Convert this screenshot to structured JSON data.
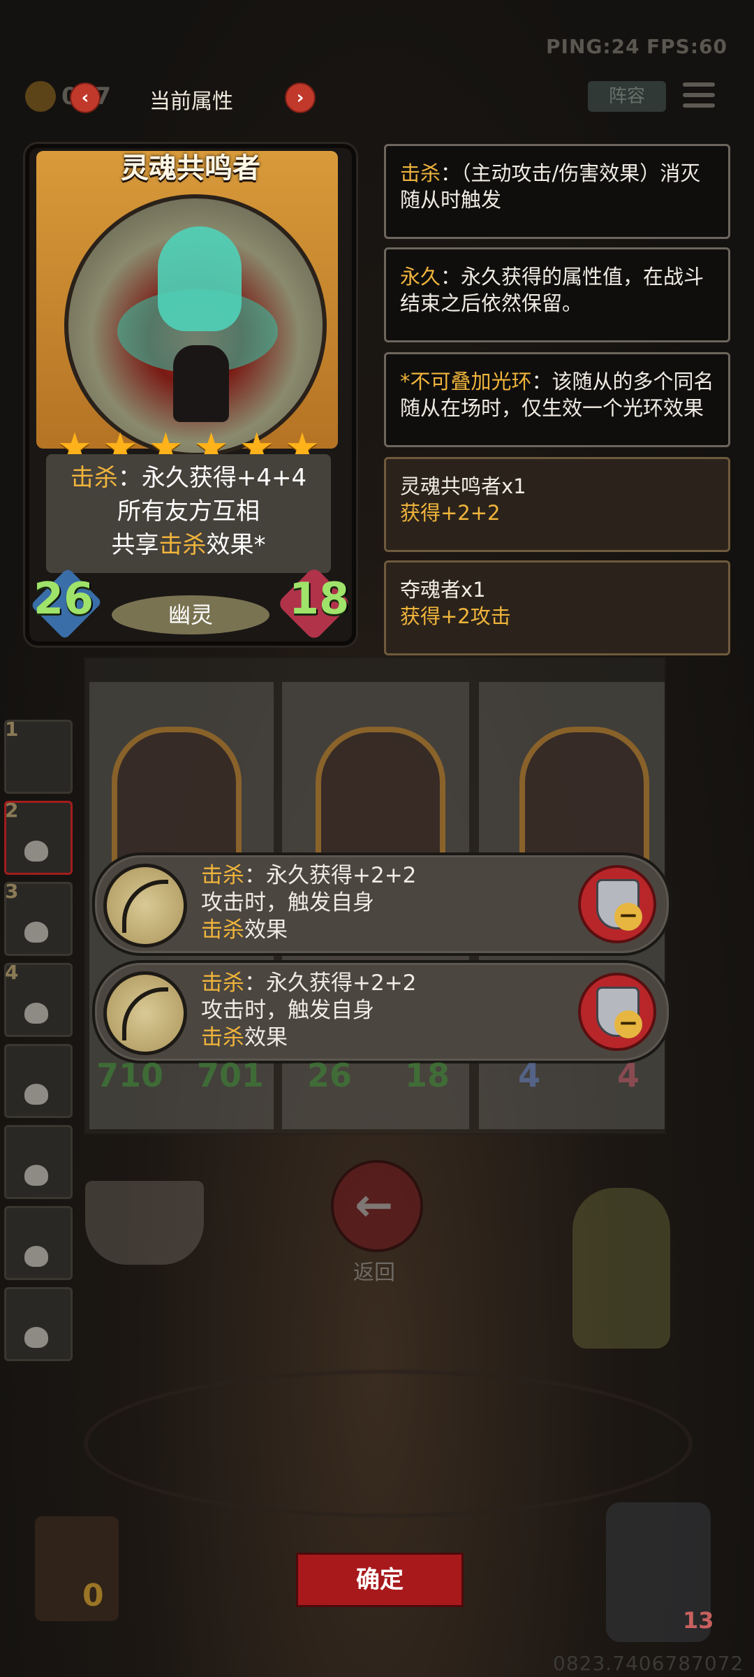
{
  "hud": {
    "ping": "PING:24",
    "fps": "FPS:60",
    "gold_amount": "017",
    "panel_title": "当前属性",
    "prev_arrow": "‹",
    "next_arrow": "›",
    "lineup_label": "阵容"
  },
  "card": {
    "name": "灵魂共鸣者",
    "stars": 6,
    "star_glyph": "★",
    "text_line1_kw": "击杀",
    "text_line1_rest": "：永久获得+4+4",
    "text_line2": "所有友方互相",
    "text_line3_pre": "共享",
    "text_line3_kw": "击杀",
    "text_line3_post": "效果*",
    "attack": "26",
    "health": "18",
    "tribe": "幽灵"
  },
  "tips": [
    {
      "kw": "击杀",
      "rest": "：（主动攻击/伤害效果）消灭随从时触发",
      "style": "dark"
    },
    {
      "kw": "永久",
      "rest": "：永久获得的属性值，在战斗结束之后依然保留。",
      "style": "dark"
    },
    {
      "kw": "*不可叠加光环",
      "rest": "：该随从的多个同名随从在场时，仅生效一个光环效果",
      "style": "dark"
    },
    {
      "line1": "灵魂共鸣者x1",
      "line2": "获得+2+2",
      "style": "brown"
    },
    {
      "line1": "夺魂者x1",
      "line2": "获得+2攻击",
      "style": "brown"
    }
  ],
  "side_cards": [
    "1",
    "2",
    "3",
    "4"
  ],
  "effects": [
    {
      "kw1": "击杀",
      "line1_rest": "：永久获得+2+2",
      "line2": "攻击时，触发自身",
      "kw3": "击杀",
      "line3_rest": "效果"
    },
    {
      "kw1": "击杀",
      "line1_rest": "：永久获得+2+2",
      "line2": "攻击时，触发自身",
      "kw3": "击杀",
      "line3_rest": "效果"
    }
  ],
  "board_stats": [
    "710",
    "701",
    "26",
    "18",
    "4",
    "4"
  ],
  "back_label": "返回",
  "back_arrow": "←",
  "confirm_label": "确定",
  "deck_count": "0",
  "player_hp": "13",
  "uid": "0823.7406787072",
  "colors": {
    "keyword": "#f0b43c",
    "confirm": "#a8191c",
    "stat_green": "#9fe36a"
  }
}
